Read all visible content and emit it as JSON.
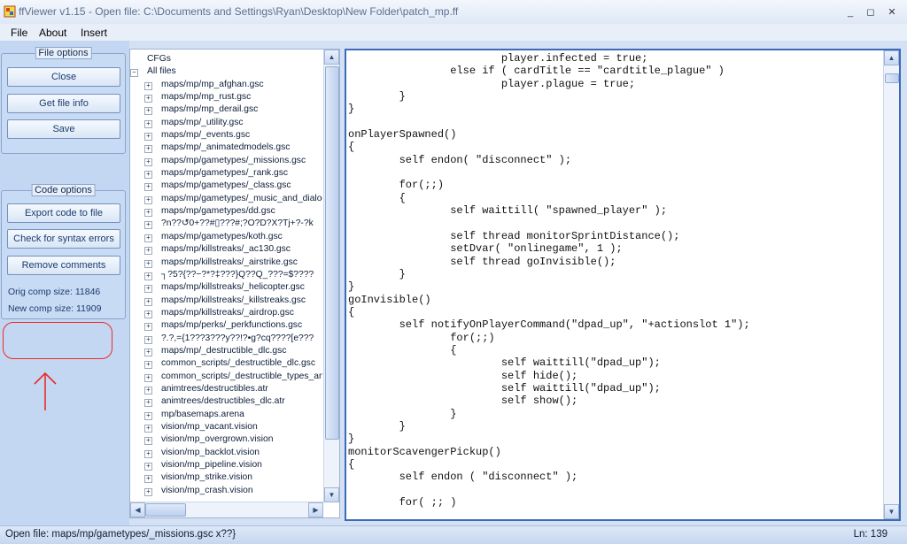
{
  "window": {
    "title": "ffViewer v1.15 - Open file: C:\\Documents and Settings\\Ryan\\Desktop\\New Folder\\patch_mp.ff",
    "minimize": "_",
    "restore": "◻",
    "close": "✕"
  },
  "menu": {
    "items": [
      "File",
      "About",
      "Insert"
    ]
  },
  "file_options": {
    "title": "File options",
    "close_label": "Close",
    "file_info_label": "Get file info",
    "save_label": "Save"
  },
  "code_options": {
    "title": "Code options",
    "export_label": "Export code to file",
    "syntax_label": "Check for syntax errors",
    "remove_comments_label": "Remove comments",
    "orig_size": "Orig comp size: 11846",
    "new_size": "New comp size: 11909"
  },
  "tree": {
    "items": [
      {
        "label": "CFGs",
        "level": 0,
        "expander": ""
      },
      {
        "label": "All files",
        "level": 0,
        "expander": "−"
      },
      {
        "label": "maps/mp/mp_afghan.gsc",
        "level": 1,
        "expander": "+"
      },
      {
        "label": "maps/mp/mp_rust.gsc",
        "level": 1,
        "expander": "+"
      },
      {
        "label": "maps/mp/mp_derail.gsc",
        "level": 1,
        "expander": "+"
      },
      {
        "label": "maps/mp/_utility.gsc",
        "level": 1,
        "expander": "+"
      },
      {
        "label": "maps/mp/_events.gsc",
        "level": 1,
        "expander": "+"
      },
      {
        "label": "maps/mp/_animatedmodels.gsc",
        "level": 1,
        "expander": "+"
      },
      {
        "label": "maps/mp/gametypes/_missions.gsc",
        "level": 1,
        "expander": "+"
      },
      {
        "label": "maps/mp/gametypes/_rank.gsc",
        "level": 1,
        "expander": "+"
      },
      {
        "label": "maps/mp/gametypes/_class.gsc",
        "level": 1,
        "expander": "+"
      },
      {
        "label": "maps/mp/gametypes/_music_and_dialog.gsc",
        "level": 1,
        "expander": "+"
      },
      {
        "label": "maps/mp/gametypes/dd.gsc",
        "level": 1,
        "expander": "+"
      },
      {
        "label": "?n??↺0+??#▯???#;?O?D?X?Tj+?-?k",
        "level": 1,
        "expander": "+"
      },
      {
        "label": "maps/mp/gametypes/koth.gsc",
        "level": 1,
        "expander": "+"
      },
      {
        "label": "maps/mp/killstreaks/_ac130.gsc",
        "level": 1,
        "expander": "+"
      },
      {
        "label": "maps/mp/killstreaks/_airstrike.gsc",
        "level": 1,
        "expander": "+"
      },
      {
        "label": "┐?5?{??−?*?‡???}Q??Q_???=$????",
        "level": 1,
        "expander": "+"
      },
      {
        "label": "maps/mp/killstreaks/_helicopter.gsc",
        "level": 1,
        "expander": "+"
      },
      {
        "label": "maps/mp/killstreaks/_killstreaks.gsc",
        "level": 1,
        "expander": "+"
      },
      {
        "label": "maps/mp/killstreaks/_airdrop.gsc",
        "level": 1,
        "expander": "+"
      },
      {
        "label": "maps/mp/perks/_perkfunctions.gsc",
        "level": 1,
        "expander": "+"
      },
      {
        "label": "?.?,={1???3???y??!?•g?cq????[e???",
        "level": 1,
        "expander": "+"
      },
      {
        "label": "maps/mp/_destructible_dlc.gsc",
        "level": 1,
        "expander": "+"
      },
      {
        "label": "common_scripts/_destructible_dlc.gsc",
        "level": 1,
        "expander": "+"
      },
      {
        "label": "common_scripts/_destructible_types_anim.gsc",
        "level": 1,
        "expander": "+"
      },
      {
        "label": "animtrees/destructibles.atr",
        "level": 1,
        "expander": "+"
      },
      {
        "label": "animtrees/destructibles_dlc.atr",
        "level": 1,
        "expander": "+"
      },
      {
        "label": "mp/basemaps.arena",
        "level": 1,
        "expander": "+"
      },
      {
        "label": "vision/mp_vacant.vision",
        "level": 1,
        "expander": "+"
      },
      {
        "label": "vision/mp_overgrown.vision",
        "level": 1,
        "expander": "+"
      },
      {
        "label": "vision/mp_backlot.vision",
        "level": 1,
        "expander": "+"
      },
      {
        "label": "vision/mp_pipeline.vision",
        "level": 1,
        "expander": "+"
      },
      {
        "label": "vision/mp_strike.vision",
        "level": 1,
        "expander": "+"
      },
      {
        "label": "vision/mp_crash.vision",
        "level": 1,
        "expander": "+"
      }
    ]
  },
  "code": {
    "lines": [
      "                        player.infected = true;",
      "                else if ( cardTitle == \"cardtitle_plague\" )",
      "                        player.plague = true;",
      "        }",
      "}",
      "",
      "onPlayerSpawned()",
      "{",
      "        self endon( \"disconnect\" );",
      "",
      "        for(;;)",
      "        {",
      "                self waittill( \"spawned_player\" );",
      "",
      "                self thread monitorSprintDistance();",
      "                setDvar( \"onlinegame\", 1 );",
      "                self thread goInvisible();",
      "        }",
      "}",
      "goInvisible()",
      "{",
      "        self notifyOnPlayerCommand(\"dpad_up\", \"+actionslot 1\");",
      "                for(;;)",
      "                {",
      "                        self waittill(\"dpad_up\");",
      "                        self hide();",
      "                        self waittill(\"dpad_up\");",
      "                        self show();",
      "                }",
      "        }",
      "}",
      "monitorScavengerPickup()",
      "{",
      "        self endon ( \"disconnect\" );",
      "",
      "        for( ;; )"
    ]
  },
  "status": {
    "open_file": "Open file: maps/mp/gametypes/_missions.gsc  x??}",
    "line": "Ln: 139"
  },
  "scrollbars": {
    "tree_vertical_position": 0.05,
    "tree_horizontal_position": 0.0,
    "code_vertical_position": 0.02
  },
  "icons": {
    "app": "ff-app-icon",
    "scroll_up": "▲",
    "scroll_down": "▼",
    "scroll_left": "◀",
    "scroll_right": "▶"
  },
  "colors": {
    "accent": "#3b6bb8",
    "annotation": "#ea2a2a"
  }
}
